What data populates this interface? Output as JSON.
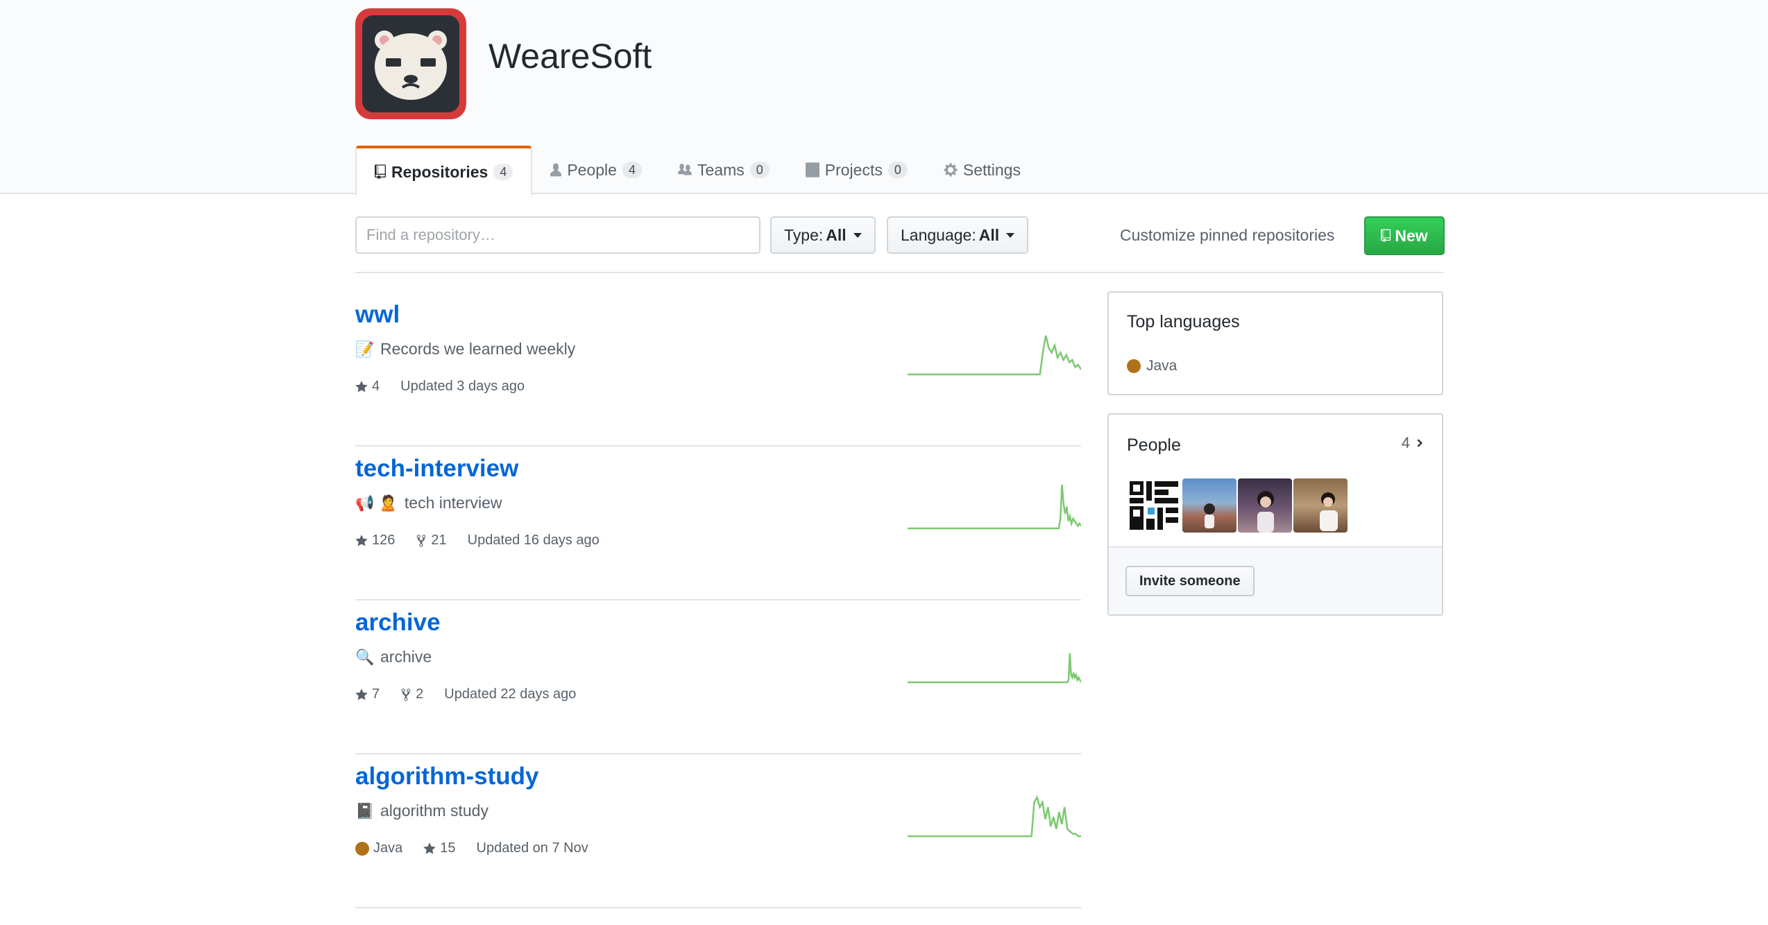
{
  "org": {
    "name": "WeareSoft",
    "avatar_icon": "polar-bear-logo"
  },
  "tabs": [
    {
      "label": "Repositories",
      "count": "4",
      "icon": "repo-icon"
    },
    {
      "label": "People",
      "count": "4",
      "icon": "person-icon"
    },
    {
      "label": "Teams",
      "count": "0",
      "icon": "team-icon"
    },
    {
      "label": "Projects",
      "count": "0",
      "icon": "project-icon"
    },
    {
      "label": "Settings",
      "icon": "gear-icon"
    }
  ],
  "filters": {
    "search_placeholder": "Find a repository…",
    "type_label": "Type:",
    "type_value": "All",
    "language_label": "Language:",
    "language_value": "All",
    "customize_label": "Customize pinned repositories",
    "new_label": "New"
  },
  "repos": [
    {
      "name": "wwl",
      "emoji": "📝",
      "description": "Records we learned weekly",
      "stars": "4",
      "updated": "Updated 3 days ago",
      "activity": [
        0,
        0,
        0,
        0,
        0,
        0,
        0,
        0,
        0,
        0,
        0,
        0,
        0,
        0,
        0,
        0,
        0,
        0,
        0,
        0,
        0,
        0,
        0,
        0,
        0,
        0,
        0,
        0,
        0,
        0,
        0,
        0,
        0,
        0,
        0,
        0,
        0,
        0,
        0,
        0,
        0,
        0,
        0,
        0,
        0,
        0,
        9,
        16,
        11,
        9,
        12,
        7,
        9,
        6,
        8,
        5,
        6,
        3,
        4,
        2
      ]
    },
    {
      "name": "tech-interview",
      "emoji": "📢 🙎",
      "description": "tech interview",
      "stars": "126",
      "forks": "21",
      "updated": "Updated 16 days ago",
      "activity": [
        0,
        0,
        0,
        0,
        0,
        0,
        0,
        0,
        0,
        0,
        0,
        0,
        0,
        0,
        0,
        0,
        0,
        0,
        0,
        0,
        0,
        0,
        0,
        0,
        0,
        0,
        0,
        0,
        0,
        0,
        0,
        0,
        0,
        0,
        0,
        0,
        0,
        0,
        0,
        0,
        0,
        0,
        0,
        0,
        0,
        0,
        0,
        0,
        0,
        0,
        0,
        0,
        0,
        0,
        0,
        0,
        0,
        0,
        0,
        0,
        0,
        0,
        0,
        0,
        0,
        0,
        0,
        0,
        0,
        0,
        0,
        0,
        0,
        0,
        0,
        0,
        0,
        0,
        0,
        0,
        0,
        0,
        0,
        0,
        0,
        0,
        0,
        0,
        0,
        0,
        0,
        0,
        0,
        0,
        0,
        0,
        4,
        18,
        10,
        6,
        9,
        3,
        5,
        2,
        4,
        3,
        2,
        1,
        2,
        1
      ]
    },
    {
      "name": "archive",
      "emoji": "🔍",
      "description": "archive",
      "stars": "7",
      "forks": "2",
      "updated": "Updated 22 days ago",
      "activity": [
        0,
        0,
        0,
        0,
        0,
        0,
        0,
        0,
        0,
        0,
        0,
        0,
        0,
        0,
        0,
        0,
        0,
        0,
        0,
        0,
        0,
        0,
        0,
        0,
        0,
        0,
        0,
        0,
        0,
        0,
        0,
        0,
        0,
        0,
        0,
        0,
        0,
        0,
        0,
        0,
        0,
        0,
        0,
        0,
        0,
        0,
        0,
        0,
        0,
        0,
        0,
        0,
        0,
        0,
        0,
        0,
        0,
        0,
        0,
        0,
        0,
        0,
        0,
        0,
        0,
        0,
        0,
        0,
        0,
        0,
        0,
        0,
        0,
        0,
        0,
        0,
        0,
        0,
        0,
        0,
        0,
        0,
        0,
        0,
        0,
        0,
        0,
        0,
        0,
        0,
        0,
        0,
        0,
        0,
        0,
        0,
        0,
        0,
        0,
        0,
        0,
        0,
        0,
        0,
        0,
        0,
        0,
        0,
        0,
        0,
        0,
        0,
        0,
        0,
        0,
        0,
        0,
        0,
        0,
        0,
        0,
        0,
        0,
        0,
        0,
        0,
        0,
        0,
        0,
        1,
        12,
        3,
        2,
        4,
        2,
        3,
        1,
        2,
        1,
        0
      ]
    },
    {
      "name": "algorithm-study",
      "emoji": "📓",
      "description": "algorithm study",
      "language": "Java",
      "stars": "15",
      "updated": "Updated on 7 Nov",
      "activity": [
        0,
        0,
        0,
        0,
        0,
        0,
        0,
        0,
        0,
        0,
        0,
        0,
        0,
        0,
        0,
        0,
        0,
        0,
        0,
        0,
        0,
        0,
        0,
        0,
        0,
        0,
        0,
        0,
        0,
        0,
        0,
        0,
        0,
        0,
        0,
        0,
        0,
        0,
        0,
        0,
        0,
        0,
        0,
        0,
        0,
        0,
        14,
        16,
        12,
        14,
        7,
        12,
        4,
        8,
        3,
        10,
        5,
        12,
        3,
        2,
        1,
        1,
        0,
        0
      ]
    }
  ],
  "sidebar": {
    "top_languages": {
      "title": "Top languages",
      "items": [
        {
          "name": "Java",
          "color": "#b07219"
        }
      ]
    },
    "people": {
      "title": "People",
      "count": "4",
      "members": [
        "member-avatar-qr",
        "member-avatar-1",
        "member-avatar-2",
        "member-avatar-3"
      ],
      "invite_label": "Invite someone"
    }
  },
  "colors": {
    "accent": "#0366d6",
    "tab_highlight": "#e36209",
    "new_button": "#28a745",
    "java": "#b07219",
    "spark": "#7bc96f"
  }
}
